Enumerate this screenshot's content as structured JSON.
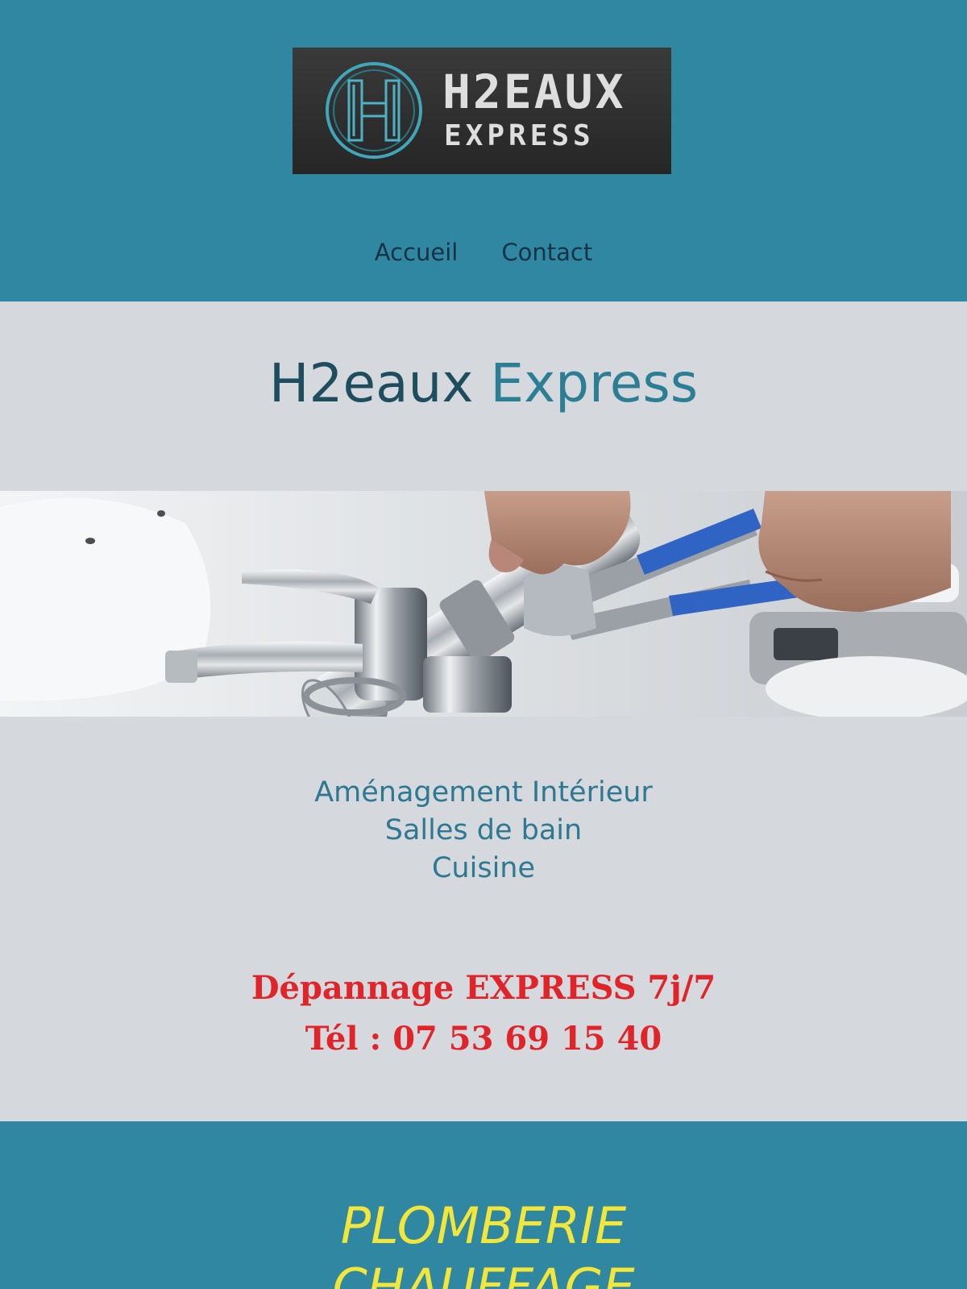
{
  "brand": {
    "logo_title": "H2EAUX",
    "logo_subtitle": "EXPRESS",
    "logo_letter": "H",
    "header_color": "#2f87a2"
  },
  "nav": {
    "items": [
      {
        "label": "Accueil"
      },
      {
        "label": "Contact"
      }
    ]
  },
  "hero": {
    "title_part1": "H2eaux",
    "title_part2": "Express",
    "photo_icon": "plumber-wrench-faucet-photo"
  },
  "services": {
    "items": [
      "Aménagement Intérieur",
      "Salles de bain",
      "Cuisine"
    ]
  },
  "emergency": {
    "line1": "Dépannage EXPRESS 7j/7",
    "line2": "Tél : 07 53 69 15 40",
    "color": "#e0242a"
  },
  "band": {
    "line1": "PLOMBERIE",
    "line2": "CHAUFFAGE",
    "text_color": "#f2e63a"
  }
}
